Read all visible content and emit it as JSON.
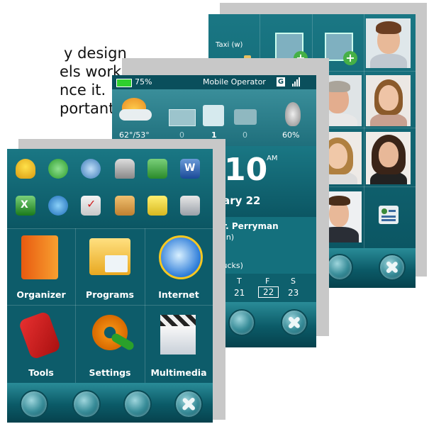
{
  "background_text": {
    "lines": [
      "y design",
      "els works",
      "nce it.",
      "portant"
    ]
  },
  "back_screen": {
    "contact_name": "Taxi (w)"
  },
  "middle_screen": {
    "status": {
      "battery": "75%",
      "operator": "Mobile Operator",
      "network_badge": "G"
    },
    "weather": {
      "temp": "62°/53°"
    },
    "counters": {
      "messages": "0",
      "calls": "1",
      "voicemail": "0",
      "volume": "60%"
    },
    "clock": {
      "time": "10",
      "ampm": "AM",
      "date": "ruary 22"
    },
    "appointment": {
      "title": "Mr. Perryman",
      "sub": "al-in)",
      "location": "rbucks)"
    },
    "calendar": {
      "days": [
        "T",
        "F",
        "S"
      ],
      "dates": [
        "21",
        "22",
        "23"
      ],
      "partial_day": "V"
    }
  },
  "front_screen": {
    "tiles": [
      {
        "label": "Organizer"
      },
      {
        "label": "Programs"
      },
      {
        "label": "Internet"
      },
      {
        "label": "Tools"
      },
      {
        "label": "Settings"
      },
      {
        "label": "Multimedia"
      }
    ],
    "icons": [
      "lightbulb-icon",
      "sync-icon",
      "globe-settings-icon",
      "lock-icon",
      "file-explorer-icon",
      "word-icon",
      "excel-icon",
      "internet-explorer-icon",
      "tasks-icon",
      "notes-icon",
      "search-note-icon",
      "calculator-icon"
    ]
  },
  "colors": {
    "panel": "#0d5c6a",
    "accent_green": "#3bd53b",
    "text": "#ffffff"
  }
}
